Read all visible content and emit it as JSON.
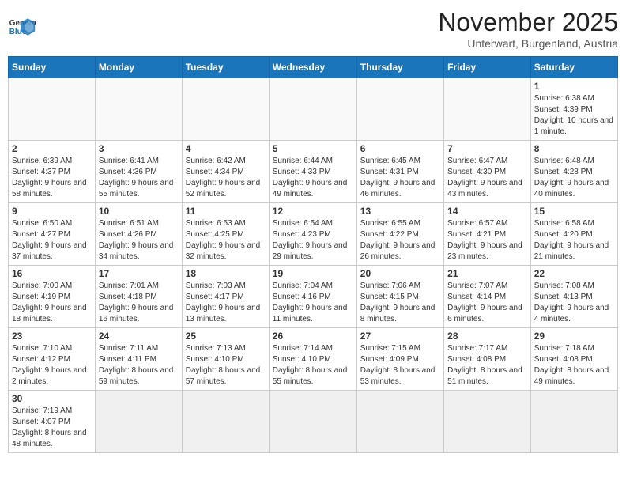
{
  "header": {
    "logo_general": "General",
    "logo_blue": "Blue",
    "month_title": "November 2025",
    "subtitle": "Unterwart, Burgenland, Austria"
  },
  "weekdays": [
    "Sunday",
    "Monday",
    "Tuesday",
    "Wednesday",
    "Thursday",
    "Friday",
    "Saturday"
  ],
  "weeks": [
    [
      {
        "day": "",
        "info": ""
      },
      {
        "day": "",
        "info": ""
      },
      {
        "day": "",
        "info": ""
      },
      {
        "day": "",
        "info": ""
      },
      {
        "day": "",
        "info": ""
      },
      {
        "day": "",
        "info": ""
      },
      {
        "day": "1",
        "info": "Sunrise: 6:38 AM\nSunset: 4:39 PM\nDaylight: 10 hours and 1 minute."
      }
    ],
    [
      {
        "day": "2",
        "info": "Sunrise: 6:39 AM\nSunset: 4:37 PM\nDaylight: 9 hours and 58 minutes."
      },
      {
        "day": "3",
        "info": "Sunrise: 6:41 AM\nSunset: 4:36 PM\nDaylight: 9 hours and 55 minutes."
      },
      {
        "day": "4",
        "info": "Sunrise: 6:42 AM\nSunset: 4:34 PM\nDaylight: 9 hours and 52 minutes."
      },
      {
        "day": "5",
        "info": "Sunrise: 6:44 AM\nSunset: 4:33 PM\nDaylight: 9 hours and 49 minutes."
      },
      {
        "day": "6",
        "info": "Sunrise: 6:45 AM\nSunset: 4:31 PM\nDaylight: 9 hours and 46 minutes."
      },
      {
        "day": "7",
        "info": "Sunrise: 6:47 AM\nSunset: 4:30 PM\nDaylight: 9 hours and 43 minutes."
      },
      {
        "day": "8",
        "info": "Sunrise: 6:48 AM\nSunset: 4:28 PM\nDaylight: 9 hours and 40 minutes."
      }
    ],
    [
      {
        "day": "9",
        "info": "Sunrise: 6:50 AM\nSunset: 4:27 PM\nDaylight: 9 hours and 37 minutes."
      },
      {
        "day": "10",
        "info": "Sunrise: 6:51 AM\nSunset: 4:26 PM\nDaylight: 9 hours and 34 minutes."
      },
      {
        "day": "11",
        "info": "Sunrise: 6:53 AM\nSunset: 4:25 PM\nDaylight: 9 hours and 32 minutes."
      },
      {
        "day": "12",
        "info": "Sunrise: 6:54 AM\nSunset: 4:23 PM\nDaylight: 9 hours and 29 minutes."
      },
      {
        "day": "13",
        "info": "Sunrise: 6:55 AM\nSunset: 4:22 PM\nDaylight: 9 hours and 26 minutes."
      },
      {
        "day": "14",
        "info": "Sunrise: 6:57 AM\nSunset: 4:21 PM\nDaylight: 9 hours and 23 minutes."
      },
      {
        "day": "15",
        "info": "Sunrise: 6:58 AM\nSunset: 4:20 PM\nDaylight: 9 hours and 21 minutes."
      }
    ],
    [
      {
        "day": "16",
        "info": "Sunrise: 7:00 AM\nSunset: 4:19 PM\nDaylight: 9 hours and 18 minutes."
      },
      {
        "day": "17",
        "info": "Sunrise: 7:01 AM\nSunset: 4:18 PM\nDaylight: 9 hours and 16 minutes."
      },
      {
        "day": "18",
        "info": "Sunrise: 7:03 AM\nSunset: 4:17 PM\nDaylight: 9 hours and 13 minutes."
      },
      {
        "day": "19",
        "info": "Sunrise: 7:04 AM\nSunset: 4:16 PM\nDaylight: 9 hours and 11 minutes."
      },
      {
        "day": "20",
        "info": "Sunrise: 7:06 AM\nSunset: 4:15 PM\nDaylight: 9 hours and 8 minutes."
      },
      {
        "day": "21",
        "info": "Sunrise: 7:07 AM\nSunset: 4:14 PM\nDaylight: 9 hours and 6 minutes."
      },
      {
        "day": "22",
        "info": "Sunrise: 7:08 AM\nSunset: 4:13 PM\nDaylight: 9 hours and 4 minutes."
      }
    ],
    [
      {
        "day": "23",
        "info": "Sunrise: 7:10 AM\nSunset: 4:12 PM\nDaylight: 9 hours and 2 minutes."
      },
      {
        "day": "24",
        "info": "Sunrise: 7:11 AM\nSunset: 4:11 PM\nDaylight: 8 hours and 59 minutes."
      },
      {
        "day": "25",
        "info": "Sunrise: 7:13 AM\nSunset: 4:10 PM\nDaylight: 8 hours and 57 minutes."
      },
      {
        "day": "26",
        "info": "Sunrise: 7:14 AM\nSunset: 4:10 PM\nDaylight: 8 hours and 55 minutes."
      },
      {
        "day": "27",
        "info": "Sunrise: 7:15 AM\nSunset: 4:09 PM\nDaylight: 8 hours and 53 minutes."
      },
      {
        "day": "28",
        "info": "Sunrise: 7:17 AM\nSunset: 4:08 PM\nDaylight: 8 hours and 51 minutes."
      },
      {
        "day": "29",
        "info": "Sunrise: 7:18 AM\nSunset: 4:08 PM\nDaylight: 8 hours and 49 minutes."
      }
    ],
    [
      {
        "day": "30",
        "info": "Sunrise: 7:19 AM\nSunset: 4:07 PM\nDaylight: 8 hours and 48 minutes."
      },
      {
        "day": "",
        "info": ""
      },
      {
        "day": "",
        "info": ""
      },
      {
        "day": "",
        "info": ""
      },
      {
        "day": "",
        "info": ""
      },
      {
        "day": "",
        "info": ""
      },
      {
        "day": "",
        "info": ""
      }
    ]
  ]
}
